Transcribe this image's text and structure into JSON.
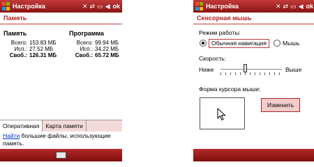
{
  "colors": {
    "titlebar": "#a21c1c",
    "accent": "#b22222",
    "tab_inactive": "#f3dada",
    "link": "#0033cc"
  },
  "screen_memory": {
    "app_title": "Настройка",
    "ok_label": "ok",
    "status_icons": [
      "signal-x-icon",
      "sync-icon",
      "battery-icon",
      "volume-icon"
    ],
    "page_title": "Память",
    "memory": {
      "heading": "Память",
      "rows": [
        {
          "label": "Всего:",
          "value": "153.83 МБ"
        },
        {
          "label": "Исп.:",
          "value": "27.52 МБ"
        },
        {
          "label": "Своб.:",
          "value": "126.31 МБ"
        }
      ]
    },
    "program": {
      "heading": "Программа",
      "rows": [
        {
          "label": "Всего:",
          "value": "99.94 МБ"
        },
        {
          "label": "Исп.:",
          "value": "34.22 МБ"
        },
        {
          "label": "Своб.:",
          "value": "65.72 МБ"
        }
      ]
    },
    "tabs": [
      "Оперативная",
      "Карта памяти"
    ],
    "hint_link": "Найти",
    "hint_text": " большие файлы, использующие память."
  },
  "screen_mouse": {
    "app_title": "Настройка",
    "ok_label": "ok",
    "page_title": "Сенсорная мышь",
    "mode_label": "Режим работы:",
    "option_nav": "Обычная навигация",
    "option_mouse": "Мышь",
    "selected_option": "nav",
    "speed_label": "Скорость:",
    "speed_low": "Ниже",
    "speed_high": "Выше",
    "speed_value": 0.4,
    "cursor_label": "Форма курсора мыши:",
    "change_button": "Изменить"
  }
}
